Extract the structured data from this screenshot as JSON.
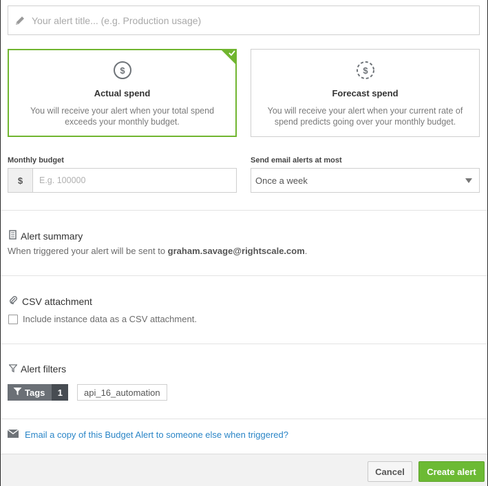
{
  "alert_title": {
    "placeholder": "Your alert title... (e.g. Production usage)",
    "value": ""
  },
  "cards": [
    {
      "title": "Actual spend",
      "description": "You will receive your alert when your total spend exceeds your monthly budget.",
      "selected": true
    },
    {
      "title": "Forecast spend",
      "description": "You will receive your alert when your current rate of spend predicts going over your monthly budget.",
      "selected": false
    }
  ],
  "budget": {
    "label": "Monthly budget",
    "prefix": "$",
    "placeholder": "E.g. 100000",
    "value": ""
  },
  "frequency": {
    "label": "Send email alerts at most",
    "selected": "Once a week"
  },
  "summary": {
    "title": "Alert summary",
    "text_prefix": "When triggered your alert will be sent to ",
    "email": "graham.savage@rightscale.com",
    "text_suffix": "."
  },
  "csv": {
    "title": "CSV attachment",
    "checkbox_label": "Include instance data as a CSV attachment.",
    "checked": false
  },
  "filters": {
    "title": "Alert filters",
    "tags_label": "Tags",
    "tags_count": "1",
    "tags": [
      "api_16_automation"
    ]
  },
  "email_copy_link": "Email a copy of this Budget Alert to someone else when triggered?",
  "buttons": {
    "cancel": "Cancel",
    "create": "Create alert"
  },
  "colors": {
    "accent_green": "#70b52f",
    "link_blue": "#2a85c7",
    "create_button": "#6cba34"
  },
  "icons": {
    "title": "pencil-icon",
    "actual": "dollar-circle-icon",
    "forecast": "dollar-dashed-circle-icon",
    "summary": "document-icon",
    "csv": "paperclip-icon",
    "filters": "funnel-icon",
    "email": "envelope-icon"
  }
}
